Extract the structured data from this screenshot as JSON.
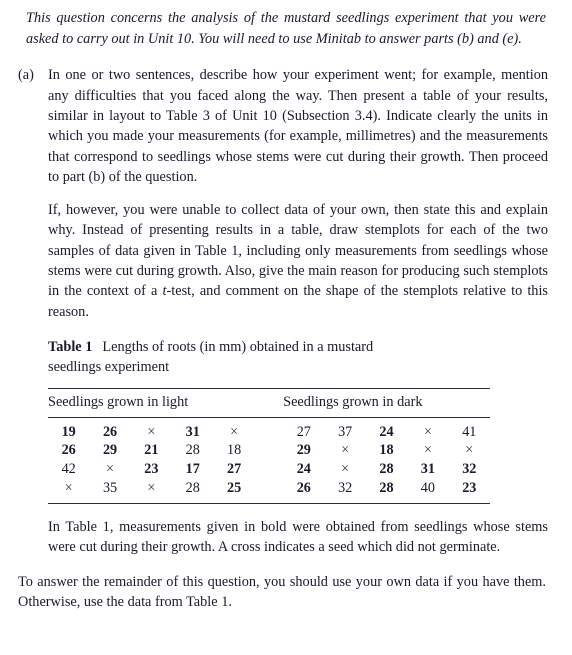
{
  "intro": {
    "text": "This question concerns the analysis of the mustard seedlings experiment that you were asked to carry out in Unit 10. You will need to use Minitab to answer parts (b) and (e)."
  },
  "part_a": {
    "label": "(a)",
    "paragraph_1": "In one or two sentences, describe how your experiment went; for example, mention any difficulties that you faced along the way. Then present a table of your results, similar in layout to Table 3 of Unit 10 (Subsection 3.4). Indicate clearly the units in which you made your measurements (for example, millimetres) and the measurements that correspond to seedlings whose stems were cut during their growth. Then proceed to part (b) of the question.",
    "paragraph_2_lead": "If, however, you were unable to collect data of your own, then state this and explain why. Instead of presenting results in a table, draw stemplots for each of the two samples of data given in Table 1, including only measurements from seedlings whose stems were cut during growth. Also, give the main reason for producing such stemplots in the context of a ",
    "paragraph_2_italic": "t",
    "paragraph_2_tail": "-test, and comment on the shape of the stemplots relative to this reason.",
    "note": "In Table 1, measurements given in bold were obtained from seedlings whose stems were cut during their growth. A cross indicates a seed which did not germinate."
  },
  "table": {
    "caption_label": "Table 1",
    "caption_text": "Lengths of roots (in mm) obtained in a mustard seedlings experiment",
    "headers": [
      "Seedlings grown in light",
      "Seedlings grown in dark"
    ],
    "cross_symbol": "×",
    "light": [
      [
        {
          "v": "19",
          "bold": true
        },
        {
          "v": "26",
          "bold": true
        },
        {
          "v": "×",
          "cross": true
        },
        {
          "v": "31",
          "bold": true
        },
        {
          "v": "×",
          "cross": true
        }
      ],
      [
        {
          "v": "26",
          "bold": true
        },
        {
          "v": "29",
          "bold": true
        },
        {
          "v": "21",
          "bold": true
        },
        {
          "v": "28",
          "bold": false
        },
        {
          "v": "18",
          "bold": false
        }
      ],
      [
        {
          "v": "42",
          "bold": false
        },
        {
          "v": "×",
          "cross": true
        },
        {
          "v": "23",
          "bold": true
        },
        {
          "v": "17",
          "bold": true
        },
        {
          "v": "27",
          "bold": true
        }
      ],
      [
        {
          "v": "×",
          "cross": true
        },
        {
          "v": "35",
          "bold": false
        },
        {
          "v": "×",
          "cross": true
        },
        {
          "v": "28",
          "bold": false
        },
        {
          "v": "25",
          "bold": true
        }
      ]
    ],
    "dark": [
      [
        {
          "v": "27",
          "bold": false
        },
        {
          "v": "37",
          "bold": false
        },
        {
          "v": "24",
          "bold": true
        },
        {
          "v": "×",
          "cross": true
        },
        {
          "v": "41",
          "bold": false
        }
      ],
      [
        {
          "v": "29",
          "bold": true
        },
        {
          "v": "×",
          "cross": true
        },
        {
          "v": "18",
          "bold": true
        },
        {
          "v": "×",
          "cross": true
        },
        {
          "v": "×",
          "cross": true
        }
      ],
      [
        {
          "v": "24",
          "bold": true
        },
        {
          "v": "×",
          "cross": true
        },
        {
          "v": "28",
          "bold": true
        },
        {
          "v": "31",
          "bold": true
        },
        {
          "v": "32",
          "bold": true
        }
      ],
      [
        {
          "v": "26",
          "bold": true
        },
        {
          "v": "32",
          "bold": false
        },
        {
          "v": "28",
          "bold": true
        },
        {
          "v": "40",
          "bold": false
        },
        {
          "v": "23",
          "bold": true
        }
      ]
    ]
  },
  "closing": {
    "text": "To answer the remainder of this question, you should use your own data if you have them. Otherwise, use the data from Table 1."
  }
}
